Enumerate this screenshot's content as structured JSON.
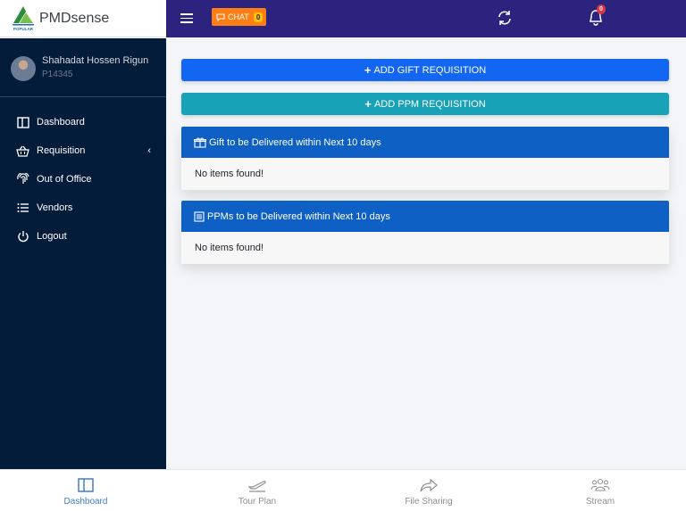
{
  "brand": {
    "name": "PMDsense",
    "logo_text": "POPULAR"
  },
  "topbar": {
    "chat_label": "CHAT",
    "chat_count": "0",
    "notification_count": "0"
  },
  "user": {
    "name": "Shahadat Hossen Rigun",
    "id": "P14345"
  },
  "sidebar": {
    "items": [
      {
        "label": "Dashboard",
        "icon": "layout-icon"
      },
      {
        "label": "Requisition",
        "icon": "basket-icon"
      },
      {
        "label": "Out of Office",
        "icon": "fingerprint-icon"
      },
      {
        "label": "Vendors",
        "icon": "list-icon"
      },
      {
        "label": "Logout",
        "icon": "power-icon"
      }
    ]
  },
  "main": {
    "add_gift_label": "ADD GIFT REQUISITION",
    "add_ppm_label": "ADD PPM REQUISITION",
    "gift_card": {
      "title": "Gift to be Delivered within Next 10 days",
      "empty_text": "No items found!"
    },
    "ppm_card": {
      "title": "PPMs to be Delivered within Next 10 days",
      "empty_text": "No items found!"
    }
  },
  "bottom_nav": {
    "items": [
      {
        "label": "Dashboard",
        "active": true
      },
      {
        "label": "Tour Plan",
        "active": false
      },
      {
        "label": "File Sharing",
        "active": false
      },
      {
        "label": "Stream",
        "active": false
      }
    ]
  },
  "colors": {
    "topbar": "#2b237d",
    "sidebar": "#021c3a",
    "primary": "#1266f1",
    "info": "#17a2b8",
    "card_header": "#0e60c4",
    "chat": "#fd7e14"
  }
}
